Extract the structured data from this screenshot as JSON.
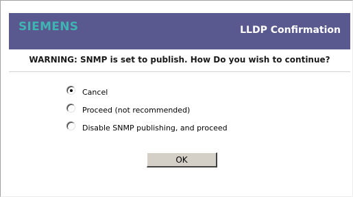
{
  "header": {
    "brand": "SIEMENS",
    "title": "LLDP Confirmation",
    "background_color": "#59598f",
    "brand_color": "#3fb5b3"
  },
  "warning": {
    "text": "WARNING: SNMP is set to publish. How Do you wish to continue?"
  },
  "options": {
    "selected": "cancel",
    "items": [
      {
        "id": "cancel",
        "label": "Cancel",
        "selected": true
      },
      {
        "id": "proceed",
        "label": "Proceed (not recommended)",
        "selected": false
      },
      {
        "id": "disable_snmp",
        "label": "Disable SNMP publishing, and proceed",
        "selected": false
      }
    ]
  },
  "ok_button": {
    "label": "OK"
  }
}
